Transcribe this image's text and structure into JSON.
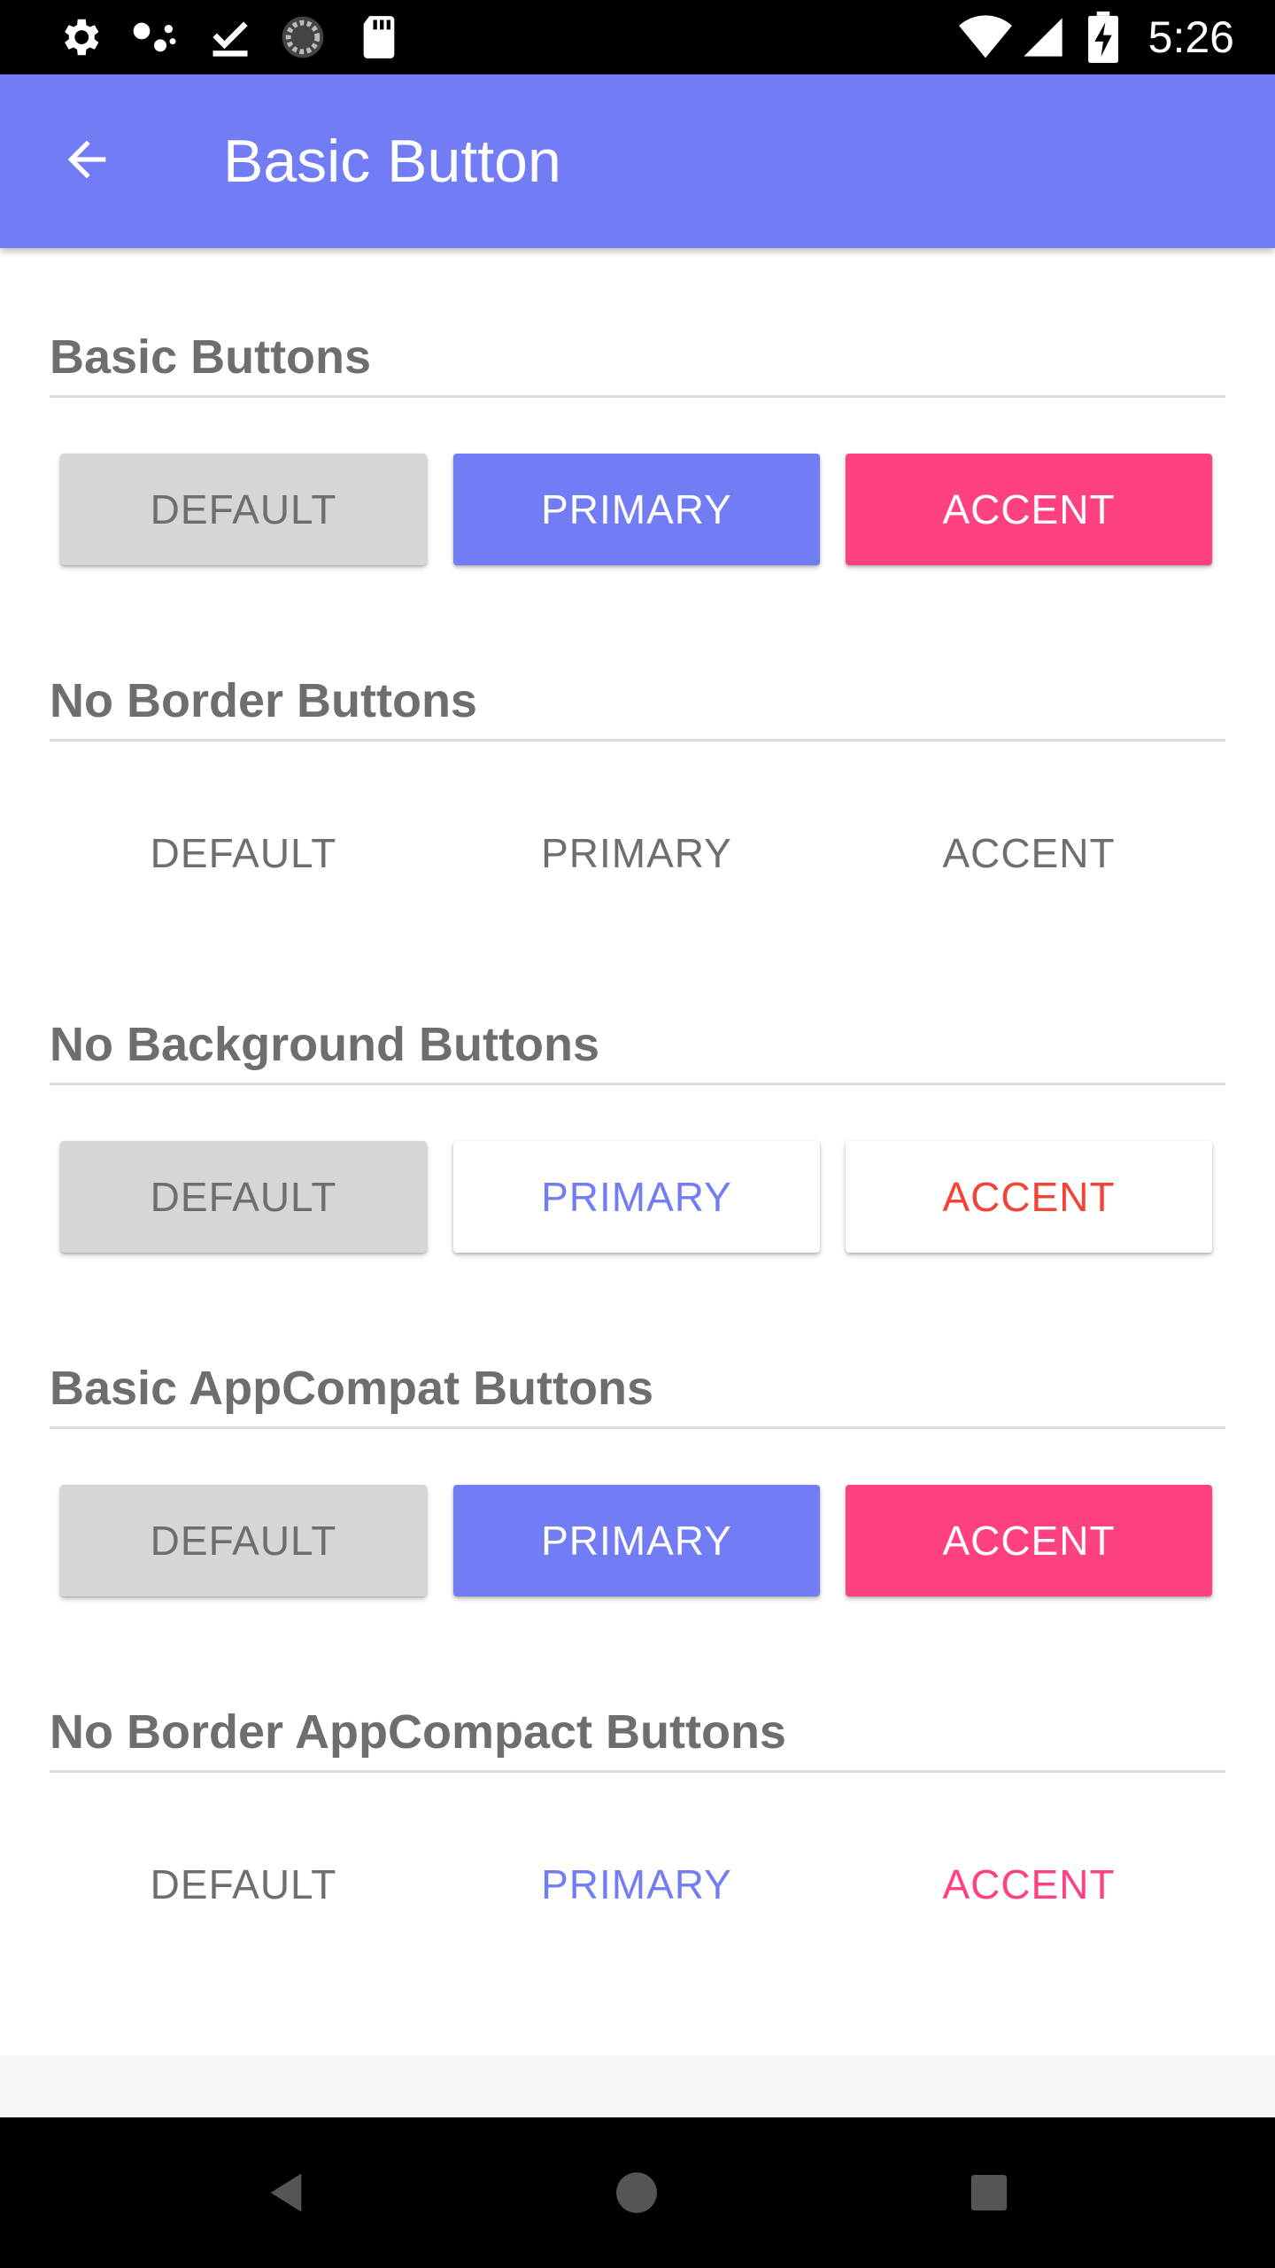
{
  "status_bar": {
    "time": "5:26",
    "left_icons": [
      "settings-icon",
      "assistant-dots-icon",
      "download-done-icon",
      "sync-circle-icon",
      "sd-card-icon"
    ],
    "right_icons": [
      "wifi-icon",
      "cellular-signal-icon",
      "battery-charging-icon"
    ]
  },
  "app_bar": {
    "title": "Basic Button",
    "back_icon": "arrow-back-icon",
    "background": "#727cf5"
  },
  "colors": {
    "primary": "#727cf5",
    "accent": "#ff4081",
    "accent_text_no_background": "#f44336",
    "default_button": "#d6d6d6",
    "default_text": "#6e6e6e",
    "section_title": "#6e6e6e"
  },
  "sections": [
    {
      "title": "Basic Buttons",
      "buttons": [
        {
          "label": "DEFAULT"
        },
        {
          "label": "PRIMARY"
        },
        {
          "label": "ACCENT"
        }
      ]
    },
    {
      "title": "No Border Buttons",
      "buttons": [
        {
          "label": "DEFAULT"
        },
        {
          "label": "PRIMARY"
        },
        {
          "label": "ACCENT"
        }
      ]
    },
    {
      "title": "No Background Buttons",
      "buttons": [
        {
          "label": "DEFAULT"
        },
        {
          "label": "PRIMARY"
        },
        {
          "label": "ACCENT"
        }
      ]
    },
    {
      "title": "Basic AppCompat Buttons",
      "buttons": [
        {
          "label": "DEFAULT"
        },
        {
          "label": "PRIMARY"
        },
        {
          "label": "ACCENT"
        }
      ]
    },
    {
      "title": "No Border AppCompact Buttons",
      "buttons": [
        {
          "label": "DEFAULT"
        },
        {
          "label": "PRIMARY"
        },
        {
          "label": "ACCENT"
        }
      ]
    }
  ],
  "nav_bar": {
    "icons": [
      "nav-back-icon",
      "nav-home-icon",
      "nav-recents-icon"
    ]
  }
}
